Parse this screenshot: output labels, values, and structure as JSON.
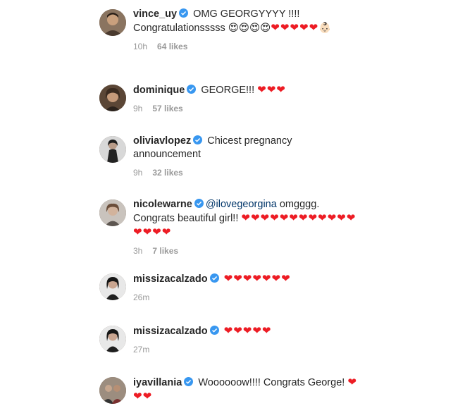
{
  "comments": [
    {
      "username": "vince_uy",
      "text": "OMG GEORGYYYY !!!! Congratulationsssss 😍😍😍😍❤❤❤❤❤👶🏻",
      "time": "10h",
      "likes": "64 likes"
    },
    {
      "username": "dominique",
      "text": "GEORGE!!! ❤❤❤",
      "time": "9h",
      "likes": "57 likes"
    },
    {
      "username": "oliviavlopez",
      "text": "Chicest pregnancy announcement",
      "time": "9h",
      "likes": "32 likes"
    },
    {
      "username": "nicolewarne",
      "mention": "@ilovegeorgina",
      "text": "omgggg. Congrats beautiful girl!! ❤❤❤❤❤❤❤❤❤❤❤❤❤❤❤❤",
      "time": "3h",
      "likes": "7 likes"
    },
    {
      "username": "missizacalzado",
      "text": "❤❤❤❤❤❤❤",
      "time": "26m",
      "likes": ""
    },
    {
      "username": "missizacalzado",
      "text": "❤❤❤❤❤",
      "time": "27m",
      "likes": ""
    },
    {
      "username": "iyavillania",
      "text": "Woooooow!!!! Congrats George! ❤❤❤",
      "time": "",
      "likes": ""
    }
  ],
  "colors": {
    "verified": "#3897f0",
    "heart": "#ed1c24",
    "meta": "#999999",
    "mention": "#003569"
  },
  "icons": {
    "verified": "verified-badge-icon"
  }
}
